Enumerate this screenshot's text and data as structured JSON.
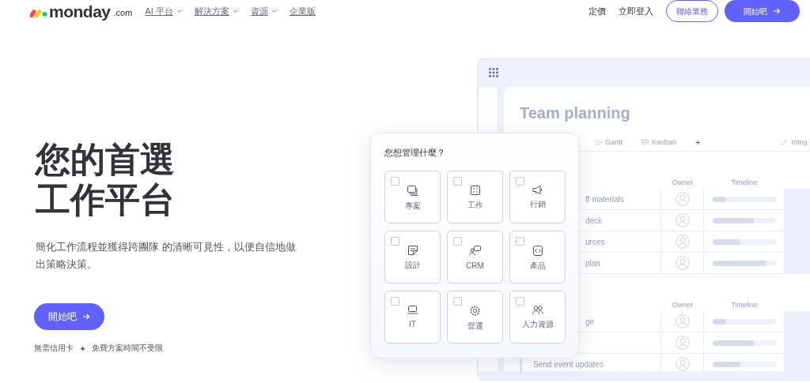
{
  "navbar": {
    "logo": {
      "brand": "monday",
      "suffix": ".com"
    },
    "menu": [
      {
        "label": "AI 平台",
        "dropdown": true
      },
      {
        "label": "解決方案",
        "dropdown": true
      },
      {
        "label": "資源",
        "dropdown": true
      },
      {
        "label": "企業版",
        "dropdown": false
      }
    ],
    "links": [
      "定價",
      "立即登入"
    ],
    "buttons": [
      {
        "label": "聯絡業務",
        "kind": "outline"
      },
      {
        "label": "開始吧",
        "kind": "primary"
      }
    ]
  },
  "hero": {
    "title": [
      "您的首選",
      "工作平台"
    ],
    "text": "簡化工作流程並獲得跨團隊 的清晰可見性，以便自信地做出策略決策。",
    "cta": "開始吧",
    "notes": [
      "無需信用卡",
      "免費方案時間不受限"
    ]
  },
  "board": {
    "title": "Team planning",
    "views": [
      {
        "label": "Gantt",
        "kind": "gantt"
      },
      {
        "label": "Kanban",
        "kind": "kanban"
      },
      {
        "label": "+",
        "kind": "add"
      }
    ],
    "integrate": "Integ",
    "groups": [
      {
        "columns": [
          "Owner",
          "Timeline"
        ],
        "rows": [
          {
            "name": "ff materials",
            "level": 0.22
          },
          {
            "name": "deck",
            "level": 0.65
          },
          {
            "name": "urces",
            "level": 0.44
          },
          {
            "name": "plan",
            "level": 0.86
          }
        ]
      },
      {
        "columns": [
          "Owner",
          "Timeline"
        ],
        "rows": [
          {
            "name": "ge",
            "level": 0.22
          },
          {
            "level": 0.65
          },
          {
            "name": "Send event updates",
            "level": 0.44
          }
        ]
      }
    ]
  },
  "popup": {
    "title": "您想管理什麼？",
    "options": [
      {
        "label": "專案",
        "kind": "projects",
        "checked": false
      },
      {
        "label": "工作",
        "kind": "tasks",
        "checked": false
      },
      {
        "label": "行銷",
        "kind": "marketing",
        "checked": false
      },
      {
        "label": "設計",
        "kind": "design",
        "checked": false
      },
      {
        "label": "CRM",
        "kind": "crm",
        "checked": false
      },
      {
        "label": "產品",
        "kind": "product",
        "checked": false
      },
      {
        "label": "IT",
        "kind": "it",
        "checked": false
      },
      {
        "label": "營運",
        "kind": "operations",
        "checked": false
      },
      {
        "label": "人力資源",
        "kind": "hr",
        "checked": false
      }
    ]
  }
}
